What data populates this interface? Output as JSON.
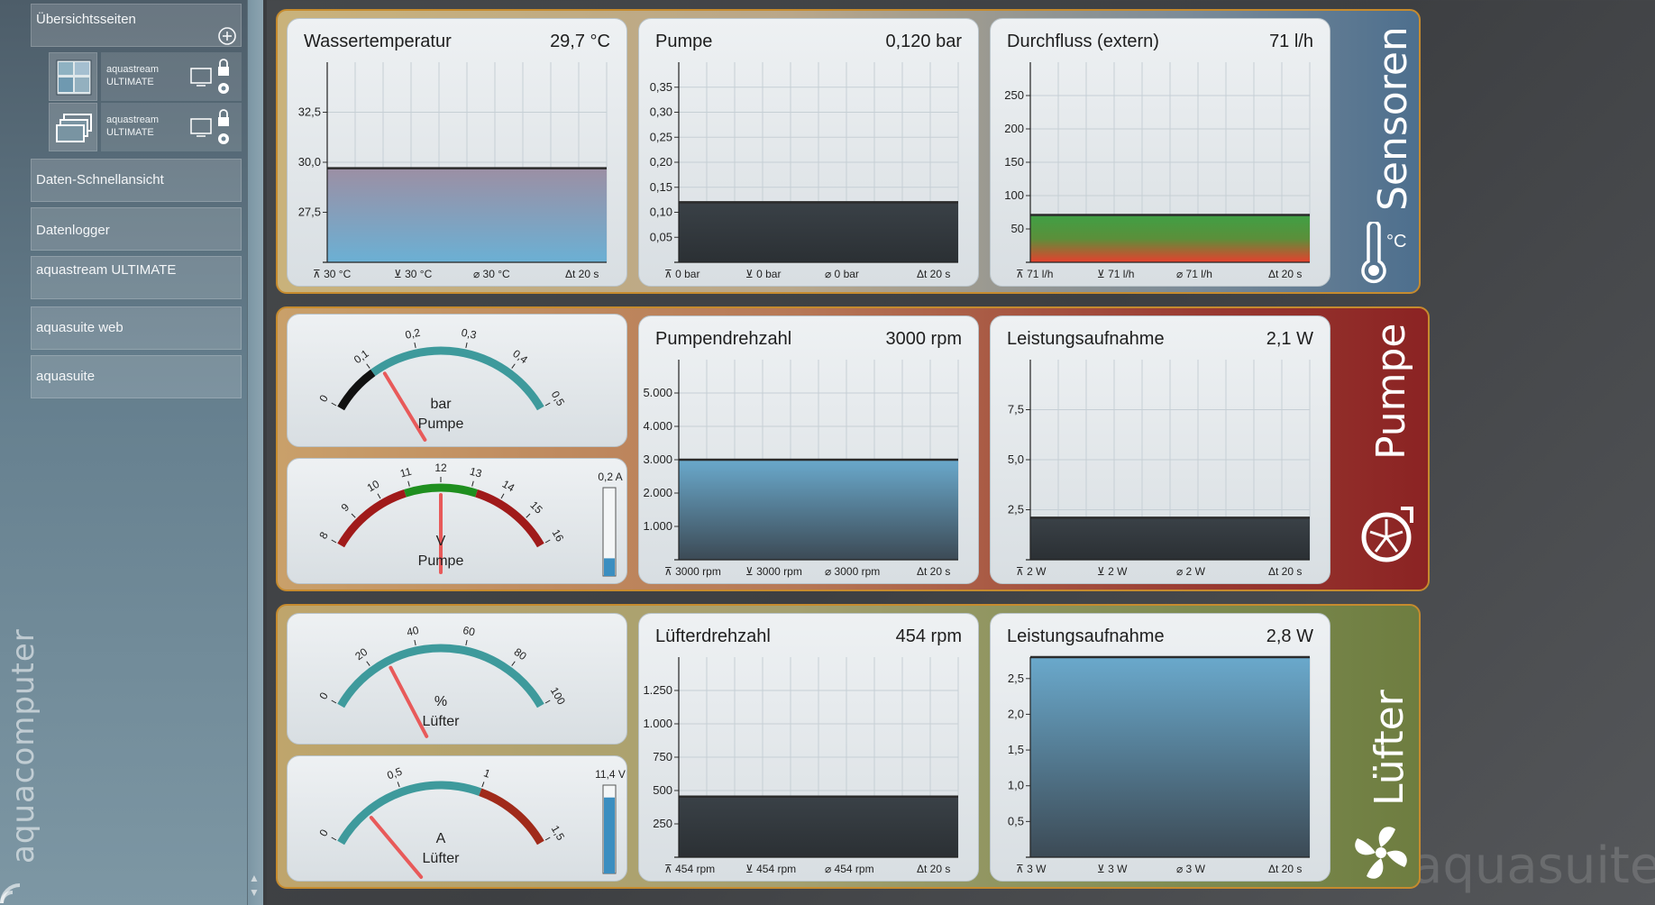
{
  "sidebar": {
    "header": "Übersichtsseiten",
    "subitems": [
      {
        "line1": "aquastream",
        "line2": "ULTIMATE"
      },
      {
        "line1": "aquastream",
        "line2": "ULTIMATE"
      }
    ],
    "items": [
      "Daten-Schnellansicht",
      "Datenlogger",
      "aquastream ULTIMATE",
      "aquasuite web",
      "aquasuite"
    ],
    "brand": "aquacomputer"
  },
  "watermark": "aquasuite",
  "groups": {
    "sensoren": "Sensoren",
    "pumpe": "Pumpe",
    "luefter": "Lüfter",
    "unit_celsius": "°C"
  },
  "charts": [
    {
      "id": "wassertemp",
      "title": "Wassertemperatur",
      "value": "29,7 °C",
      "yticks": [
        "32,5",
        "30,0",
        "27,5"
      ],
      "footer": {
        "max": "30 °C",
        "min": "30 °C",
        "avg": "30 °C",
        "span": "20 s"
      },
      "fill": "temp"
    },
    {
      "id": "pumpe",
      "title": "Pumpe",
      "value": "0,120 bar",
      "yticks": [
        "0,35",
        "0,30",
        "0,25",
        "0,20",
        "0,15",
        "0,10",
        "0,05"
      ],
      "footer": {
        "max": "0 bar",
        "min": "0 bar",
        "avg": "0 bar",
        "span": "20 s"
      },
      "fill": "dark"
    },
    {
      "id": "durchfluss",
      "title": "Durchfluss (extern)",
      "value": "71 l/h",
      "yticks": [
        "250",
        "200",
        "150",
        "100",
        "50"
      ],
      "footer": {
        "max": "71 l/h",
        "min": "71 l/h",
        "avg": "71 l/h",
        "span": "20 s"
      },
      "fill": "flow"
    },
    {
      "id": "pumpendrehzahl",
      "title": "Pumpendrehzahl",
      "value": "3000 rpm",
      "yticks": [
        "5.000",
        "4.000",
        "3.000",
        "2.000",
        "1.000"
      ],
      "footer": {
        "max": "3000 rpm",
        "min": "3000 rpm",
        "avg": "3000 rpm",
        "span": "20 s"
      },
      "fill": "blue"
    },
    {
      "id": "leistung-pumpe",
      "title": "Leistungsaufnahme",
      "value": "2,1 W",
      "yticks": [
        "7,5",
        "5,0",
        "2,5"
      ],
      "footer": {
        "max": "2 W",
        "min": "2 W",
        "avg": "2 W",
        "span": "20 s"
      },
      "fill": "dark"
    },
    {
      "id": "luefterdrehzahl",
      "title": "Lüfterdrehzahl",
      "value": "454 rpm",
      "yticks": [
        "1.250",
        "1.000",
        "750",
        "500",
        "250"
      ],
      "footer": {
        "max": "454 rpm",
        "min": "454 rpm",
        "avg": "454 rpm",
        "span": "20 s"
      },
      "fill": "dark"
    },
    {
      "id": "leistung-luefter",
      "title": "Leistungsaufnahme",
      "value": "2,8 W",
      "yticks": [
        "2,5",
        "2,0",
        "1,5",
        "1,0",
        "0,5"
      ],
      "footer": {
        "max": "3 W",
        "min": "3 W",
        "avg": "3 W",
        "span": "20 s"
      },
      "fill": "blue"
    }
  ],
  "chart_data": [
    {
      "type": "area",
      "title": "Wassertemperatur",
      "value": 29.7,
      "unit": "°C",
      "ylim": [
        25,
        35
      ],
      "yticks": [
        27.5,
        30.0,
        32.5
      ]
    },
    {
      "type": "area",
      "title": "Pumpe",
      "value": 0.12,
      "unit": "bar",
      "ylim": [
        0,
        0.4
      ],
      "yticks": [
        0.05,
        0.1,
        0.15,
        0.2,
        0.25,
        0.3,
        0.35
      ]
    },
    {
      "type": "area",
      "title": "Durchfluss (extern)",
      "value": 71,
      "unit": "l/h",
      "ylim": [
        0,
        300
      ],
      "yticks": [
        50,
        100,
        150,
        200,
        250
      ]
    },
    {
      "type": "area",
      "title": "Pumpendrehzahl",
      "value": 3000,
      "unit": "rpm",
      "ylim": [
        0,
        6000
      ],
      "yticks": [
        1000,
        2000,
        3000,
        4000,
        5000
      ]
    },
    {
      "type": "area",
      "title": "Leistungsaufnahme",
      "value": 2.1,
      "unit": "W",
      "ylim": [
        0,
        10
      ],
      "yticks": [
        2.5,
        5.0,
        7.5
      ]
    },
    {
      "type": "area",
      "title": "Lüfterdrehzahl",
      "value": 454,
      "unit": "rpm",
      "ylim": [
        0,
        1500
      ],
      "yticks": [
        250,
        500,
        750,
        1000,
        1250
      ]
    },
    {
      "type": "area",
      "title": "Leistungsaufnahme",
      "value": 2.8,
      "unit": "W",
      "ylim": [
        0,
        2.8
      ],
      "yticks": [
        0.5,
        1.0,
        1.5,
        2.0,
        2.5
      ]
    }
  ],
  "gauges": [
    {
      "id": "g-pumpe-bar",
      "unit": "bar",
      "label": "Pumpe",
      "min": 0,
      "max": 0.5,
      "value": 0.12,
      "ticks": [
        "0",
        "0,1",
        "0,2",
        "0,3",
        "0,4",
        "0,5"
      ],
      "bands": [
        {
          "from": 0,
          "to": 0.1,
          "color": "#111111"
        },
        {
          "from": 0.1,
          "to": 0.5,
          "color": "#3e9a9c"
        }
      ]
    },
    {
      "id": "g-pumpe-v",
      "unit": "V",
      "label": "Pumpe",
      "min": 8,
      "max": 16,
      "value": 12.0,
      "ticks": [
        "8",
        "9",
        "10",
        "11",
        "12",
        "13",
        "14",
        "15",
        "16"
      ],
      "bands": [
        {
          "from": 8,
          "to": 10.8,
          "color": "#a01a1a"
        },
        {
          "from": 10.8,
          "to": 13.2,
          "color": "#1f8f1f"
        },
        {
          "from": 13.2,
          "to": 16,
          "color": "#a01a1a"
        }
      ],
      "bar_label": "0,2 A",
      "bar_fraction": 0.2
    },
    {
      "id": "g-luefter-pct",
      "unit": "%",
      "label": "Lüfter",
      "min": 0,
      "max": 100,
      "value": 27,
      "ticks": [
        "0",
        "20",
        "40",
        "60",
        "80",
        "100"
      ],
      "bands": [
        {
          "from": 0,
          "to": 100,
          "color": "#3e9a9c"
        }
      ]
    },
    {
      "id": "g-luefter-a",
      "unit": "A",
      "label": "Lüfter",
      "min": 0,
      "max": 1.5,
      "value": 0.25,
      "ticks": [
        "0",
        "0,5",
        "1",
        "1,5"
      ],
      "bands": [
        {
          "from": 0,
          "to": 1.0,
          "color": "#3e9a9c"
        },
        {
          "from": 1.0,
          "to": 1.5,
          "color": "#a02a1a"
        }
      ],
      "bar_label": "11,4 V",
      "bar_fraction": 0.86
    }
  ],
  "colors": {
    "accent_border": "#c68b2e",
    "needle": "#e85a5a",
    "teal": "#3e9a9c"
  }
}
